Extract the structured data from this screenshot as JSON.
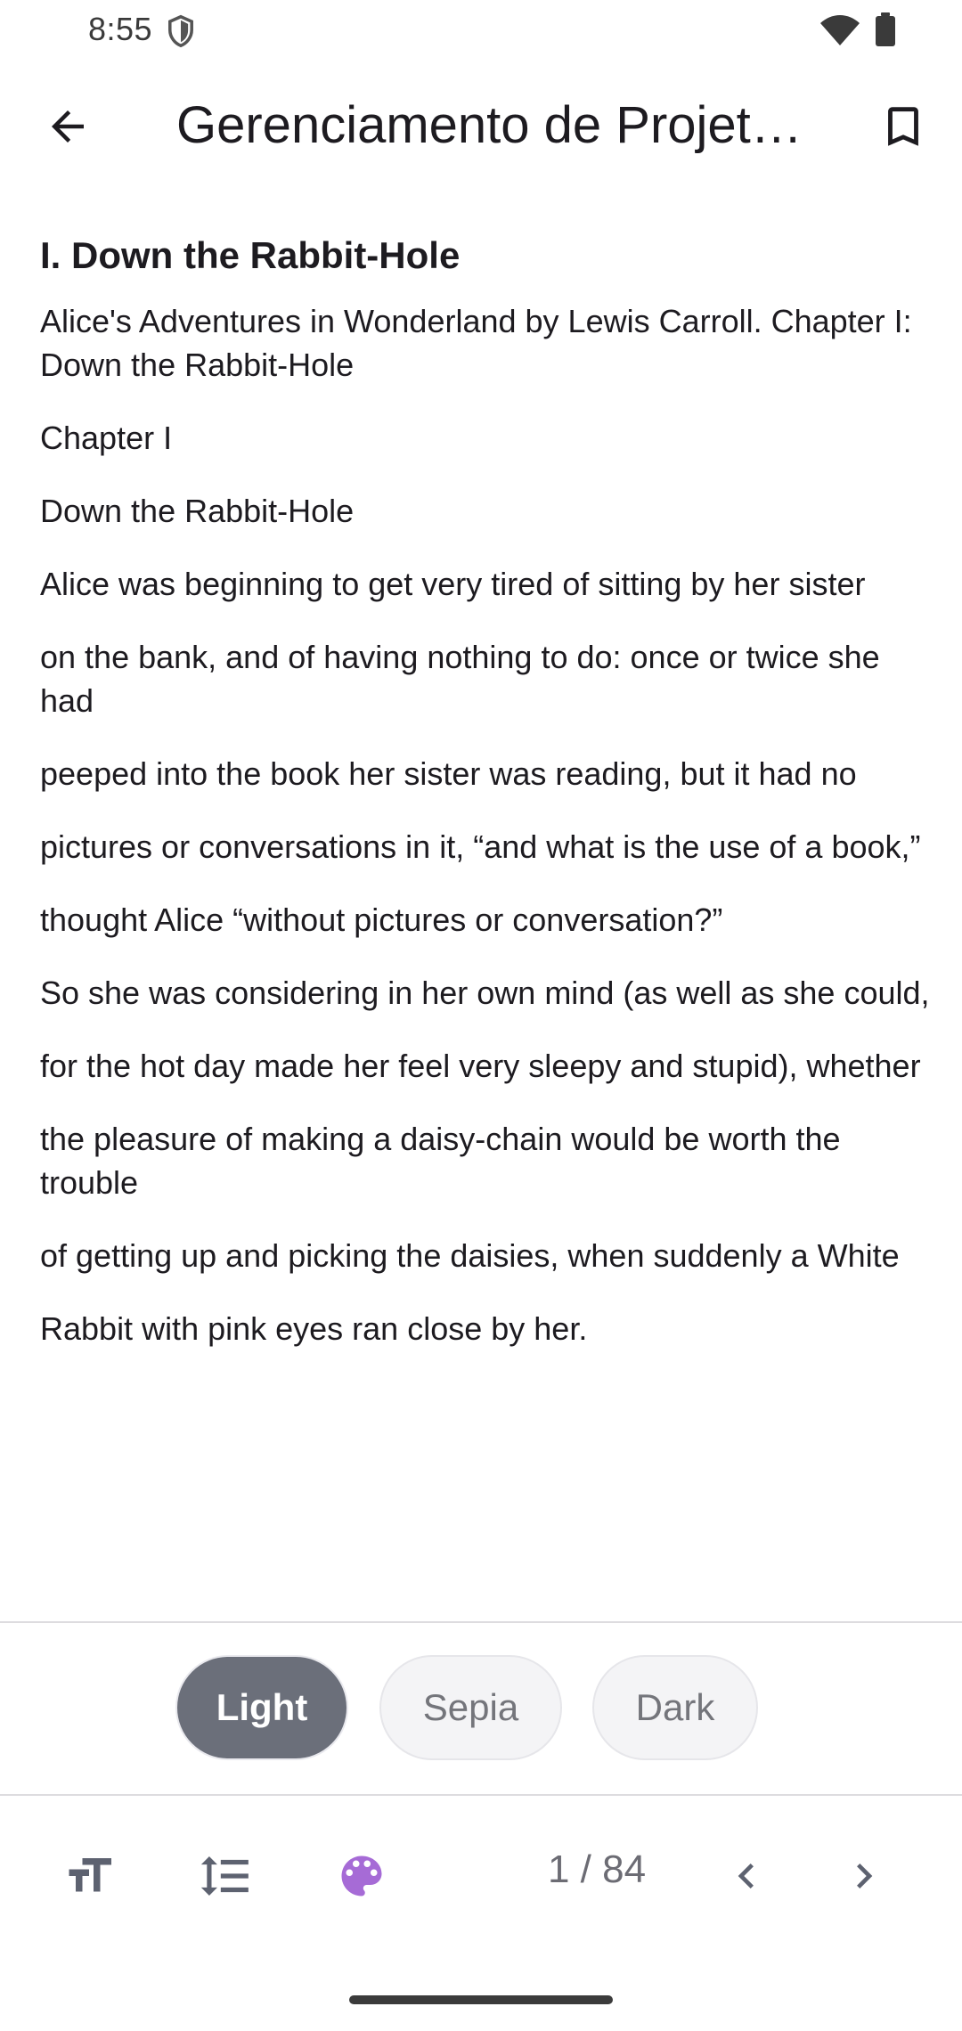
{
  "status_bar": {
    "time": "8:55",
    "icons": [
      "shield-icon",
      "wifi-icon",
      "battery-icon"
    ]
  },
  "app_bar": {
    "title": "Gerenciamento de Projet…",
    "back_icon": "arrow-back-icon",
    "bookmark_icon": "bookmark-outline-icon"
  },
  "content": {
    "heading": "I. Down the Rabbit-Hole",
    "paragraphs": [
      "Alice's Adventures in Wonderland by Lewis Carroll. Chapter I: Down the Rabbit-Hole",
      "Chapter I",
      "Down the Rabbit-Hole",
      "Alice was beginning to get very tired of sitting by her sister",
      "on the bank, and of having nothing to do:  once or twice she had",
      "peeped into the book her sister was reading, but it had no",
      "pictures or conversations in it, “and what is the use of a book,”",
      "thought Alice “without pictures or conversation?”",
      "So she was considering in her own mind (as well as she could,",
      "for the hot day made her feel very sleepy and stupid), whether",
      "the pleasure of making a daisy-chain would be worth the trouble",
      "of getting up and picking the daisies, when suddenly a White",
      "Rabbit with pink eyes ran close by her."
    ]
  },
  "themes": {
    "options": [
      "Light",
      "Sepia",
      "Dark"
    ],
    "selected": "Light"
  },
  "toolbar": {
    "font_size_icon": "text-size-icon",
    "line_spacing_icon": "line-spacing-icon",
    "theme_icon": "palette-icon",
    "page_indicator": "1 / 84",
    "prev_icon": "chevron-left-icon",
    "next_icon": "chevron-right-icon"
  },
  "colors": {
    "accent": "#a66bd6",
    "selected_chip": "#6b6f7a",
    "icon": "#5d6270",
    "text": "#1d1b20"
  }
}
